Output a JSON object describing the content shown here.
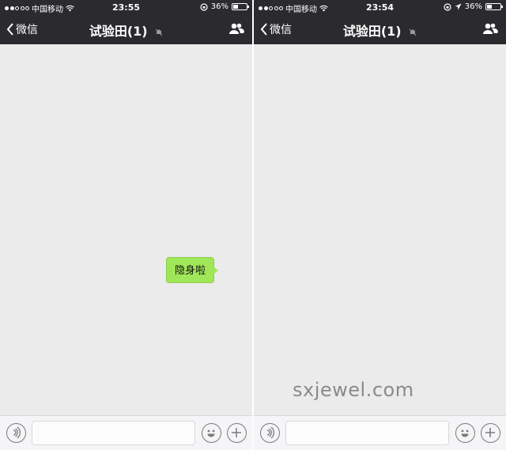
{
  "left": {
    "status": {
      "carrier": "中国移动",
      "time": "23:55",
      "battery": "36%",
      "battery_level": 0.36
    },
    "nav": {
      "back_label": "微信",
      "title": "试验田(1)"
    },
    "messages": [
      {
        "text": "隐身啦"
      }
    ]
  },
  "right": {
    "status": {
      "carrier": "中国移动",
      "time": "23:54",
      "battery": "36%",
      "battery_level": 0.36
    },
    "nav": {
      "back_label": "微信",
      "title": "试验田(1)"
    }
  },
  "watermark": "sxjewel.com",
  "colors": {
    "bar": "#2b2b2f",
    "chat_bg": "#ebebeb",
    "bubble": "#9fe758"
  },
  "icons": [
    "signal-dots-icon",
    "wifi-icon",
    "rotation-lock-icon",
    "location-arrow-icon",
    "battery-icon",
    "back-chevron-icon",
    "mute-bell-icon",
    "people-icon",
    "voice-icon",
    "emoji-icon",
    "plus-icon"
  ]
}
